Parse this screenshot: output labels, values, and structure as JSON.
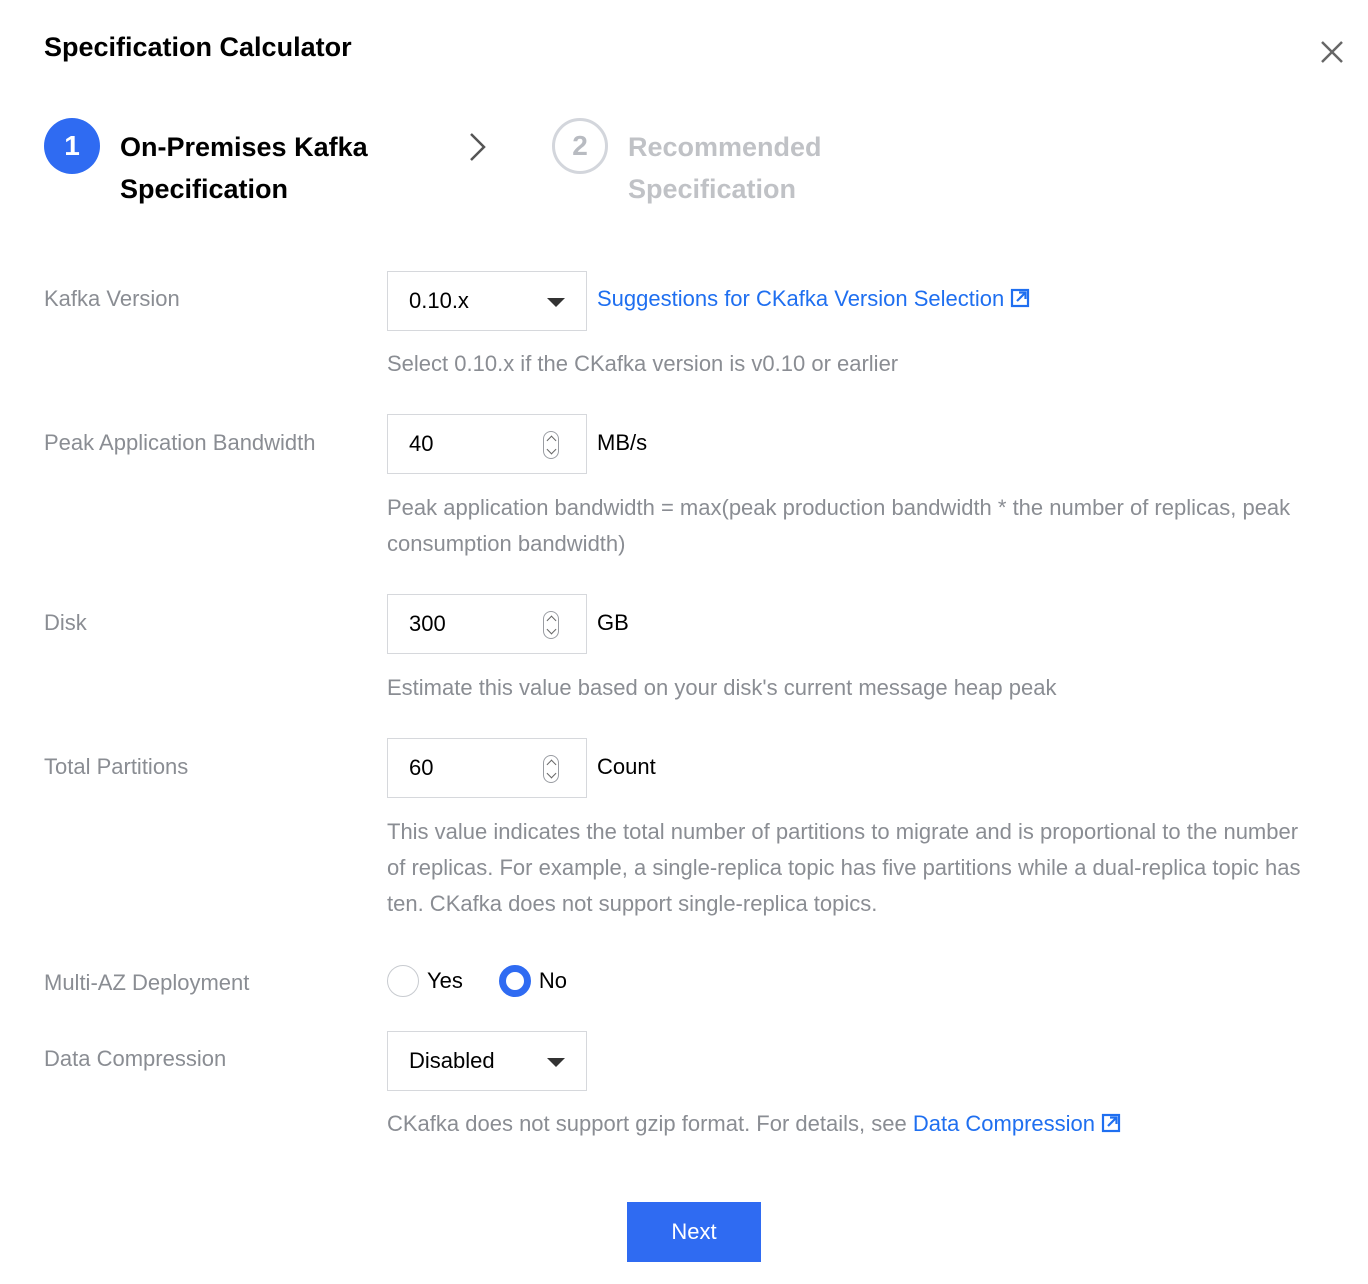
{
  "dialog": {
    "title": "Specification Calculator",
    "close_icon": "close-icon"
  },
  "steps": [
    {
      "number": "1",
      "label": "On-Premises Kafka Specification",
      "state": "active"
    },
    {
      "number": "2",
      "label": "Recommended Specification",
      "state": "inactive"
    }
  ],
  "form": {
    "kafka_version": {
      "label": "Kafka Version",
      "value": "0.10.x",
      "link": "Suggestions for CKafka Version Selection",
      "hint": "Select 0.10.x if the CKafka version is v0.10 or earlier"
    },
    "bandwidth": {
      "label": "Peak Application Bandwidth",
      "value": "40",
      "unit": "MB/s",
      "hint": "Peak application bandwidth = max(peak production bandwidth * the number of replicas, peak consumption bandwidth)"
    },
    "disk": {
      "label": "Disk",
      "value": "300",
      "unit": "GB",
      "hint": "Estimate this value based on your disk's current message heap peak"
    },
    "partitions": {
      "label": "Total Partitions",
      "value": "60",
      "unit": "Count",
      "hint": "This value indicates the total number of partitions to migrate and is proportional to the number of replicas. For example, a single-replica topic has five partitions while a dual-replica topic has ten. CKafka does not support single-replica topics."
    },
    "multi_az": {
      "label": "Multi-AZ Deployment",
      "options": [
        "Yes",
        "No"
      ],
      "selected": "No"
    },
    "compression": {
      "label": "Data Compression",
      "value": "Disabled",
      "hint": "CKafka does not support gzip format. For details, see ",
      "link": "Data Compression"
    }
  },
  "actions": {
    "next_label": "Next"
  },
  "colors": {
    "primary": "#2f6bf2",
    "link": "#1f6ff0",
    "muted": "#8a8d93"
  }
}
